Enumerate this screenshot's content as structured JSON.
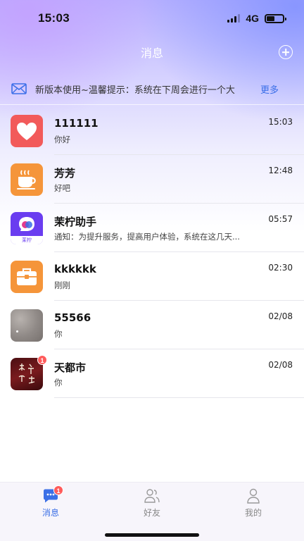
{
  "status": {
    "time": "15:03",
    "network": "4G"
  },
  "header": {
    "title": "消息"
  },
  "notice": {
    "text": "新版本使用~温馨提示：系统在下周会进行一个大",
    "more_label": "更多"
  },
  "conversations": [
    {
      "name": "111111",
      "preview": "你好",
      "time": "15:03",
      "avatar": "heart-icon"
    },
    {
      "name": "芳芳",
      "preview": "好吧",
      "time": "12:48",
      "avatar": "coffee-cup-icon"
    },
    {
      "name": "茉柠助手",
      "preview": "通知：为提升服务，提高用户体验，系统在这几天...",
      "time": "05:57",
      "avatar": "assistant-logo",
      "avatar_caption": "茉柠"
    },
    {
      "name": "kkkkkk",
      "preview": "刚刚",
      "time": "02:30",
      "avatar": "briefcase-icon"
    },
    {
      "name": "55566",
      "preview": "你",
      "time": "02/08",
      "avatar": "photo-avatar"
    },
    {
      "name": "天都市",
      "preview": "你",
      "time": "02/08",
      "avatar": "calligraphy-avatar",
      "badge": "1"
    }
  ],
  "tabbar": {
    "items": [
      {
        "label": "消息",
        "icon": "chat-bubble-icon",
        "active": true,
        "badge": "1"
      },
      {
        "label": "好友",
        "icon": "friends-icon",
        "active": false
      },
      {
        "label": "我的",
        "icon": "person-icon",
        "active": false
      }
    ]
  },
  "colors": {
    "accent": "#3b6fe6",
    "badge": "#ff5b5b",
    "heart_bg": "#f25a5a",
    "orange_bg": "#f5953a",
    "purple_bg": "#6a3df0"
  }
}
